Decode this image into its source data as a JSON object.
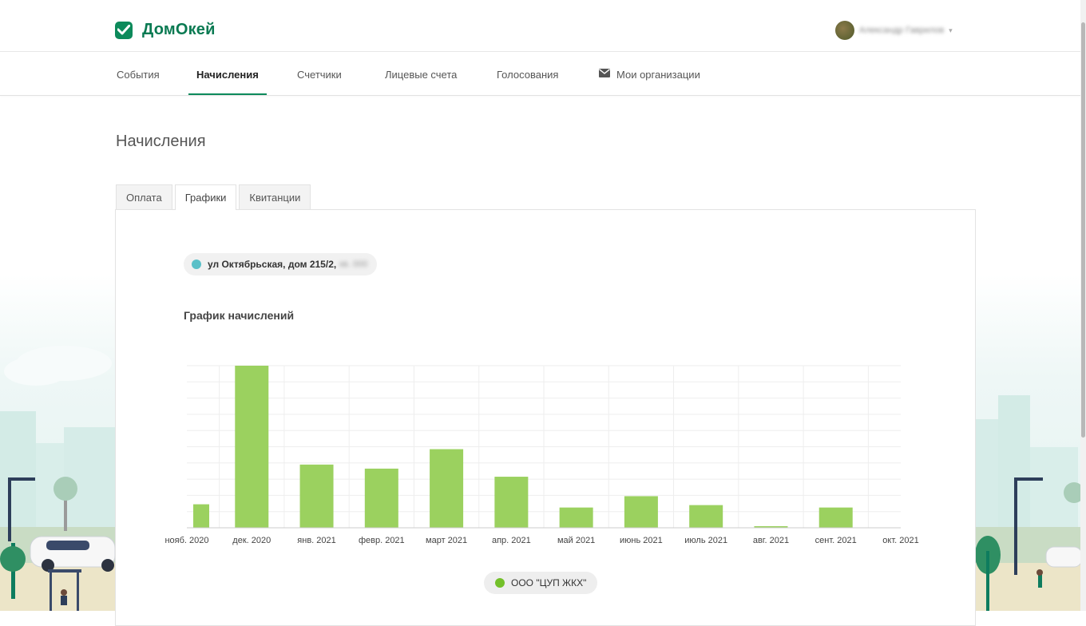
{
  "app": {
    "brand": "ДомОкей",
    "logo_icon": "check-shield-icon",
    "brand_color": "#0d8a5b"
  },
  "user": {
    "name": "Александр Гаврилов",
    "caret": "▾"
  },
  "nav": {
    "items": [
      {
        "label": "События"
      },
      {
        "label": "Начисления"
      },
      {
        "label": "Счетчики"
      },
      {
        "label": "Лицевые счета"
      },
      {
        "label": "Голосования"
      },
      {
        "label": "Мои организации",
        "icon": "mail-icon"
      }
    ],
    "active": "Начисления"
  },
  "page": {
    "title": "Начисления"
  },
  "tabs": {
    "items": [
      {
        "label": "Оплата"
      },
      {
        "label": "Графики"
      },
      {
        "label": "Квитанции"
      }
    ],
    "active": "Графики"
  },
  "address": {
    "label": "ул Октябрьская, дом 215/2,",
    "redacted": "кв. 000",
    "dot_color": "#5ac0c8"
  },
  "chart_section": {
    "title": "График начислений"
  },
  "chart_data": {
    "type": "bar",
    "categories": [
      "нояб. 2020",
      "дек. 2020",
      "янв. 2021",
      "февр. 2021",
      "март 2021",
      "апр. 2021",
      "май 2021",
      "июнь 2021",
      "июль 2021",
      "авг. 2021",
      "сент. 2021",
      "окт. 2021"
    ],
    "series": [
      {
        "name": "ООО \"ЦУП ЖКХ\"",
        "color": "#9bd15f",
        "values": [
          14.5,
          100,
          39,
          36.5,
          48.5,
          31.5,
          12.5,
          19.5,
          14,
          1,
          12.5,
          0
        ]
      }
    ],
    "ylim": [
      0,
      100
    ],
    "grid": true,
    "legend_position": "bottom-center"
  },
  "legend": {
    "label": "ООО \"ЦУП ЖКХ\"",
    "dot_color": "#73c02a"
  }
}
